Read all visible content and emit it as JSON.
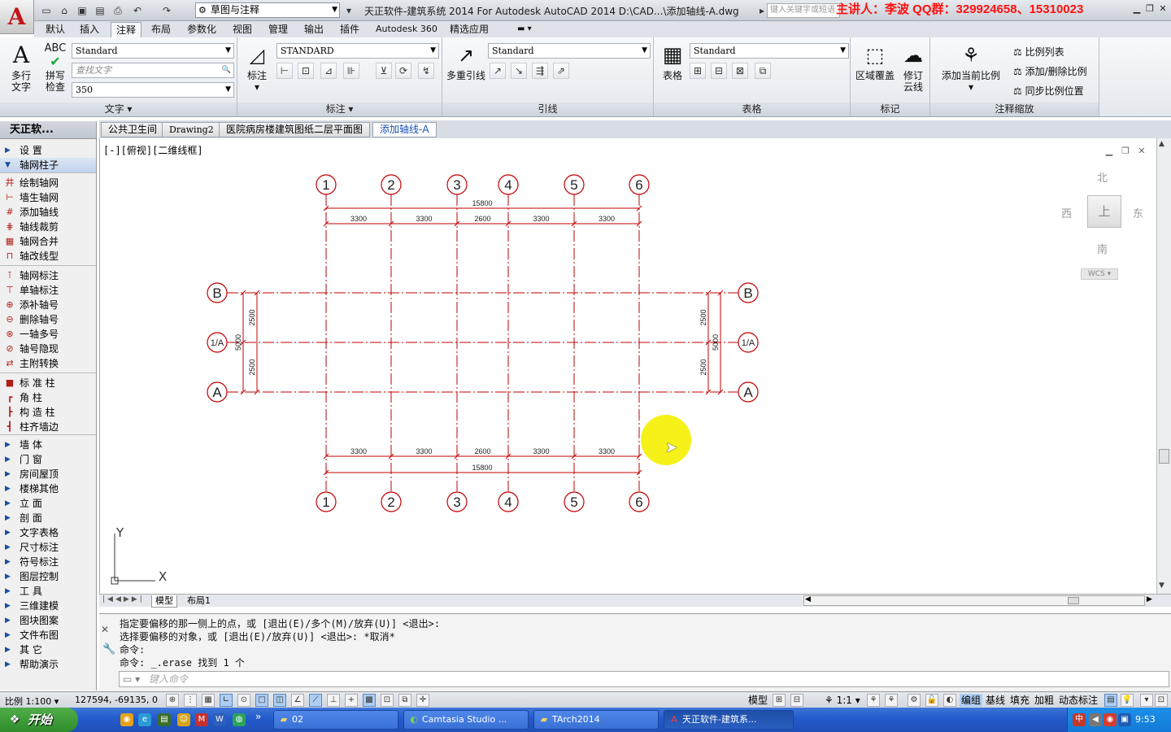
{
  "titlebar": {
    "workspace": "草图与注释",
    "title": "天正软件-建筑系统 2014  For Autodesk AutoCAD 2014    D:\\CAD...\\添加轴线-A.dwg",
    "search_placeholder": "键入关键字或短语",
    "presenter": "主讲人：李波    QQ群：329924658、15310023"
  },
  "menu_tabs": [
    "默认",
    "插入",
    "注释",
    "布局",
    "参数化",
    "视图",
    "管理",
    "输出",
    "插件",
    "Autodesk 360",
    "精选应用"
  ],
  "ribbon": {
    "text_panel": {
      "mtext_label_1": "多行",
      "mtext_label_2": "文字",
      "spell_label_1": "拼写",
      "spell_label_2": "检查",
      "style": "Standard",
      "find_placeholder": "查找文字",
      "height": "350",
      "title": "文字"
    },
    "dim_panel": {
      "label": "标注",
      "style": "STANDARD",
      "title": "标注"
    },
    "leader_panel": {
      "label": "多重引线",
      "style": "Standard",
      "title": "引线"
    },
    "table_panel": {
      "label": "表格",
      "style": "Standard",
      "title": "表格"
    },
    "markup_panel": {
      "wipeout": "区域覆盖",
      "revcloud_1": "修订",
      "revcloud_2": "云线",
      "title": "标记"
    },
    "scale_panel": {
      "add_current": "添加当前比例",
      "list": "比例列表",
      "add_del": "添加/删除比例",
      "sync": "同步比例位置",
      "title": "注释缩放"
    }
  },
  "sidebar": {
    "title": "天正软...",
    "items": [
      {
        "type": "group",
        "label": "设    置",
        "open": false
      },
      {
        "type": "group",
        "label": "轴网柱子",
        "open": true
      },
      {
        "type": "cmd",
        "label": "绘制轴网",
        "icon": "井"
      },
      {
        "type": "cmd",
        "label": "墙生轴网",
        "icon": "⊢"
      },
      {
        "type": "cmd",
        "label": "添加轴线",
        "icon": "#"
      },
      {
        "type": "cmd",
        "label": "轴线裁剪",
        "icon": "⋕"
      },
      {
        "type": "cmd",
        "label": "轴网合并",
        "icon": "▦"
      },
      {
        "type": "cmd",
        "label": "轴改线型",
        "icon": "⊓"
      },
      {
        "type": "cmd",
        "label": "轴网标注",
        "icon": "⊺"
      },
      {
        "type": "cmd",
        "label": "单轴标注",
        "icon": "⊤"
      },
      {
        "type": "cmd",
        "label": "添补轴号",
        "icon": "⊕"
      },
      {
        "type": "cmd",
        "label": "删除轴号",
        "icon": "⊖"
      },
      {
        "type": "cmd",
        "label": "一轴多号",
        "icon": "⊗"
      },
      {
        "type": "cmd",
        "label": "轴号隐现",
        "icon": "⊘"
      },
      {
        "type": "cmd",
        "label": "主附转换",
        "icon": "⇄"
      },
      {
        "type": "cmd",
        "label": "标 准 柱",
        "icon": "■"
      },
      {
        "type": "cmd",
        "label": "角    柱",
        "icon": "┏"
      },
      {
        "type": "cmd",
        "label": "构 造 柱",
        "icon": "┣"
      },
      {
        "type": "cmd",
        "label": "柱齐墙边",
        "icon": "┫"
      },
      {
        "type": "group",
        "label": "墙    体",
        "open": false
      },
      {
        "type": "group",
        "label": "门    窗",
        "open": false
      },
      {
        "type": "group",
        "label": "房间屋顶",
        "open": false
      },
      {
        "type": "group",
        "label": "楼梯其他",
        "open": false
      },
      {
        "type": "group",
        "label": "立    面",
        "open": false
      },
      {
        "type": "group",
        "label": "剖    面",
        "open": false
      },
      {
        "type": "group",
        "label": "文字表格",
        "open": false
      },
      {
        "type": "group",
        "label": "尺寸标注",
        "open": false
      },
      {
        "type": "group",
        "label": "符号标注",
        "open": false
      },
      {
        "type": "group",
        "label": "图层控制",
        "open": false
      },
      {
        "type": "group",
        "label": "工    具",
        "open": false
      },
      {
        "type": "group",
        "label": "三维建模",
        "open": false
      },
      {
        "type": "group",
        "label": "图块图案",
        "open": false
      },
      {
        "type": "group",
        "label": "文件布图",
        "open": false
      },
      {
        "type": "group",
        "label": "其    它",
        "open": false
      },
      {
        "type": "group",
        "label": "帮助演示",
        "open": false
      }
    ]
  },
  "doc_tabs": [
    "公共卫生间",
    "Drawing2",
    "医院病房楼建筑图纸二层平面图",
    "添加轴线-A"
  ],
  "viewport": {
    "label": "[-][俯视][二维线框]",
    "viewcube": {
      "north": "北",
      "south": "南",
      "east": "东",
      "west": "西",
      "top": "上",
      "wcs": "WCS"
    },
    "ucs_x": "X",
    "ucs_y": "Y"
  },
  "drawing": {
    "cols": [
      "1",
      "2",
      "3",
      "4",
      "5",
      "6"
    ],
    "rows": [
      "B",
      "1/A",
      "A"
    ],
    "bay_dims": [
      "3300",
      "3300",
      "2600",
      "3300",
      "3300"
    ],
    "total_width": "15800",
    "row_dims": [
      "2500",
      "2500"
    ],
    "total_depth": "5000",
    "line_color": "#c00000"
  },
  "layout_tabs": [
    "模型",
    "布局1"
  ],
  "command": {
    "lines": [
      "指定要偏移的那一侧上的点，或 [退出(E)/多个(M)/放弃(U)] <退出>:",
      "选择要偏移的对象，或 [退出(E)/放弃(U)] <退出>: *取消*",
      "命令:",
      "命令: _.erase 找到 1 个"
    ],
    "input_placeholder": "键入命令"
  },
  "statusbar": {
    "scale": "比例 1:100",
    "coords": "127594, -69135, 0",
    "model": "模型",
    "anno_scale": "1:1",
    "toggles": [
      "编组",
      "基线",
      "填充",
      "加粗",
      "动态标注"
    ]
  },
  "taskbar": {
    "start": "开始",
    "tasks": [
      "02",
      "Camtasia Studio ...",
      "TArch2014",
      "天正软件-建筑系..."
    ],
    "clock": "9:53"
  }
}
